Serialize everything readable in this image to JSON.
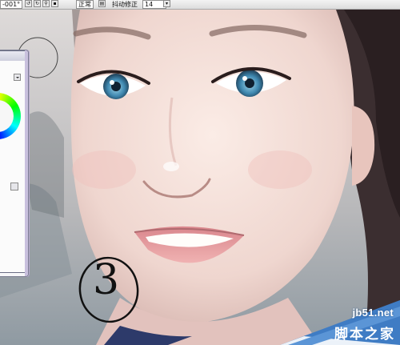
{
  "toolbar": {
    "angle": "-001°",
    "blend_mode": "正常",
    "stabilizer_label": "抖动修正",
    "stabilizer_value": "14"
  },
  "annotation": {
    "step_number": "3"
  },
  "watermark": {
    "site": "jb51.net",
    "name": "脚本之家"
  },
  "colors": {
    "skin": "#f2ddd6",
    "hair": "#3b2e30",
    "toolbar": "#e6e6e6",
    "panel_border": "#7d7f92",
    "watermark_blue": "#3f7cc4"
  }
}
